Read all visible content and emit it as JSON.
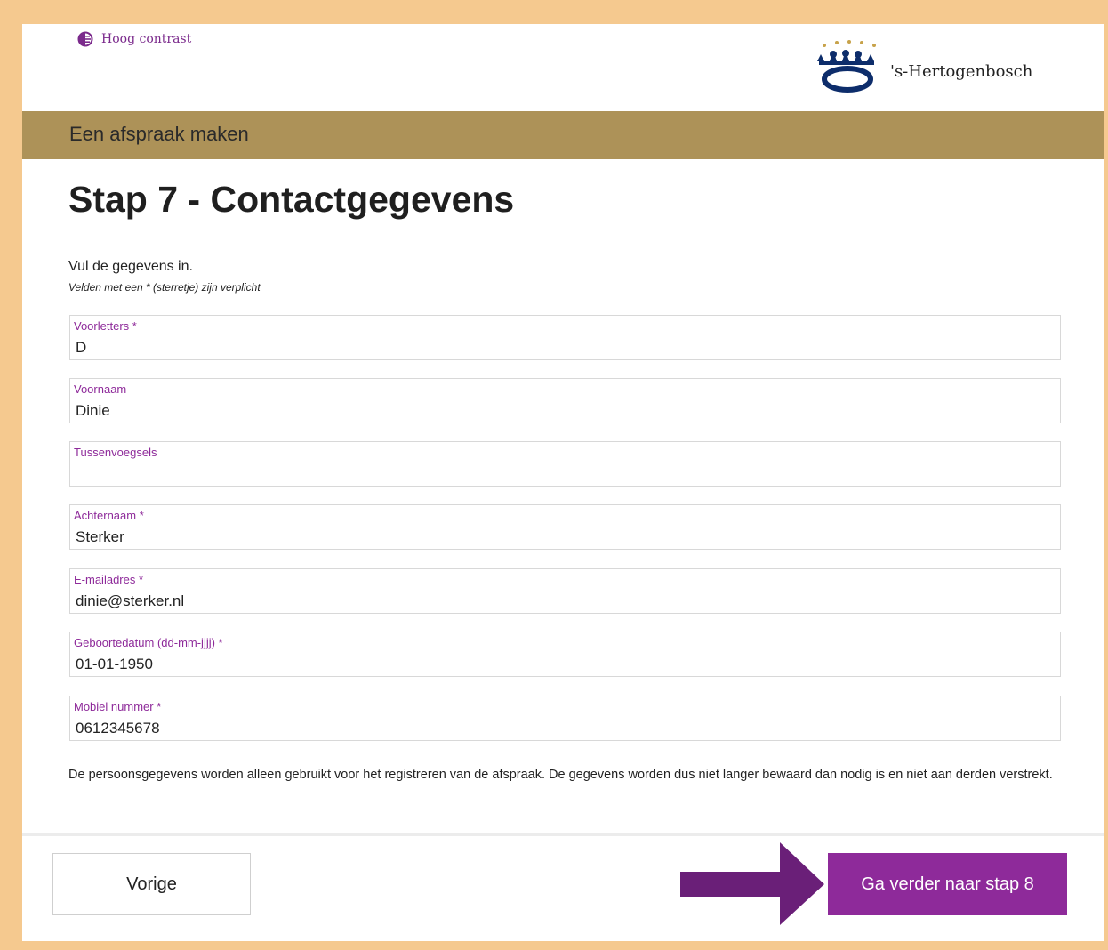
{
  "header": {
    "contrast_link": "Hoog contrast",
    "logo_text": "'s-Hertogenbosch",
    "banner_title": "Een afspraak maken"
  },
  "page": {
    "title": "Stap 7 - Contactgegevens",
    "intro": "Vul de gegevens in.",
    "required_note": "Velden met een * (sterretje) zijn verplicht"
  },
  "fields": [
    {
      "label": "Voorletters *",
      "value": "D"
    },
    {
      "label": "Voornaam",
      "value": "Dinie"
    },
    {
      "label": "Tussenvoegsels",
      "value": ""
    },
    {
      "label": "Achternaam *",
      "value": "Sterker"
    },
    {
      "label": "E-mailadres *",
      "value": "dinie@sterker.nl"
    },
    {
      "label": "Geboortedatum (dd-mm-jjjj) *",
      "value": "01-01-1950"
    },
    {
      "label": "Mobiel nummer *",
      "value": "0612345678"
    }
  ],
  "privacy_text": "De persoonsgegevens worden alleen gebruikt voor het registreren van de afspraak. De gegevens worden dus niet langer bewaard dan nodig is en niet aan derden verstrekt.",
  "buttons": {
    "previous": "Vorige",
    "next": "Ga verder naar stap 8"
  },
  "colors": {
    "accent": "#8e2a9a",
    "banner": "#ad9258",
    "page_border": "#f5c98f",
    "arrow": "#6a1f78"
  },
  "icons": {
    "contrast": "contrast-icon",
    "logo": "crown-logo-icon",
    "arrow": "arrow-right-icon"
  }
}
